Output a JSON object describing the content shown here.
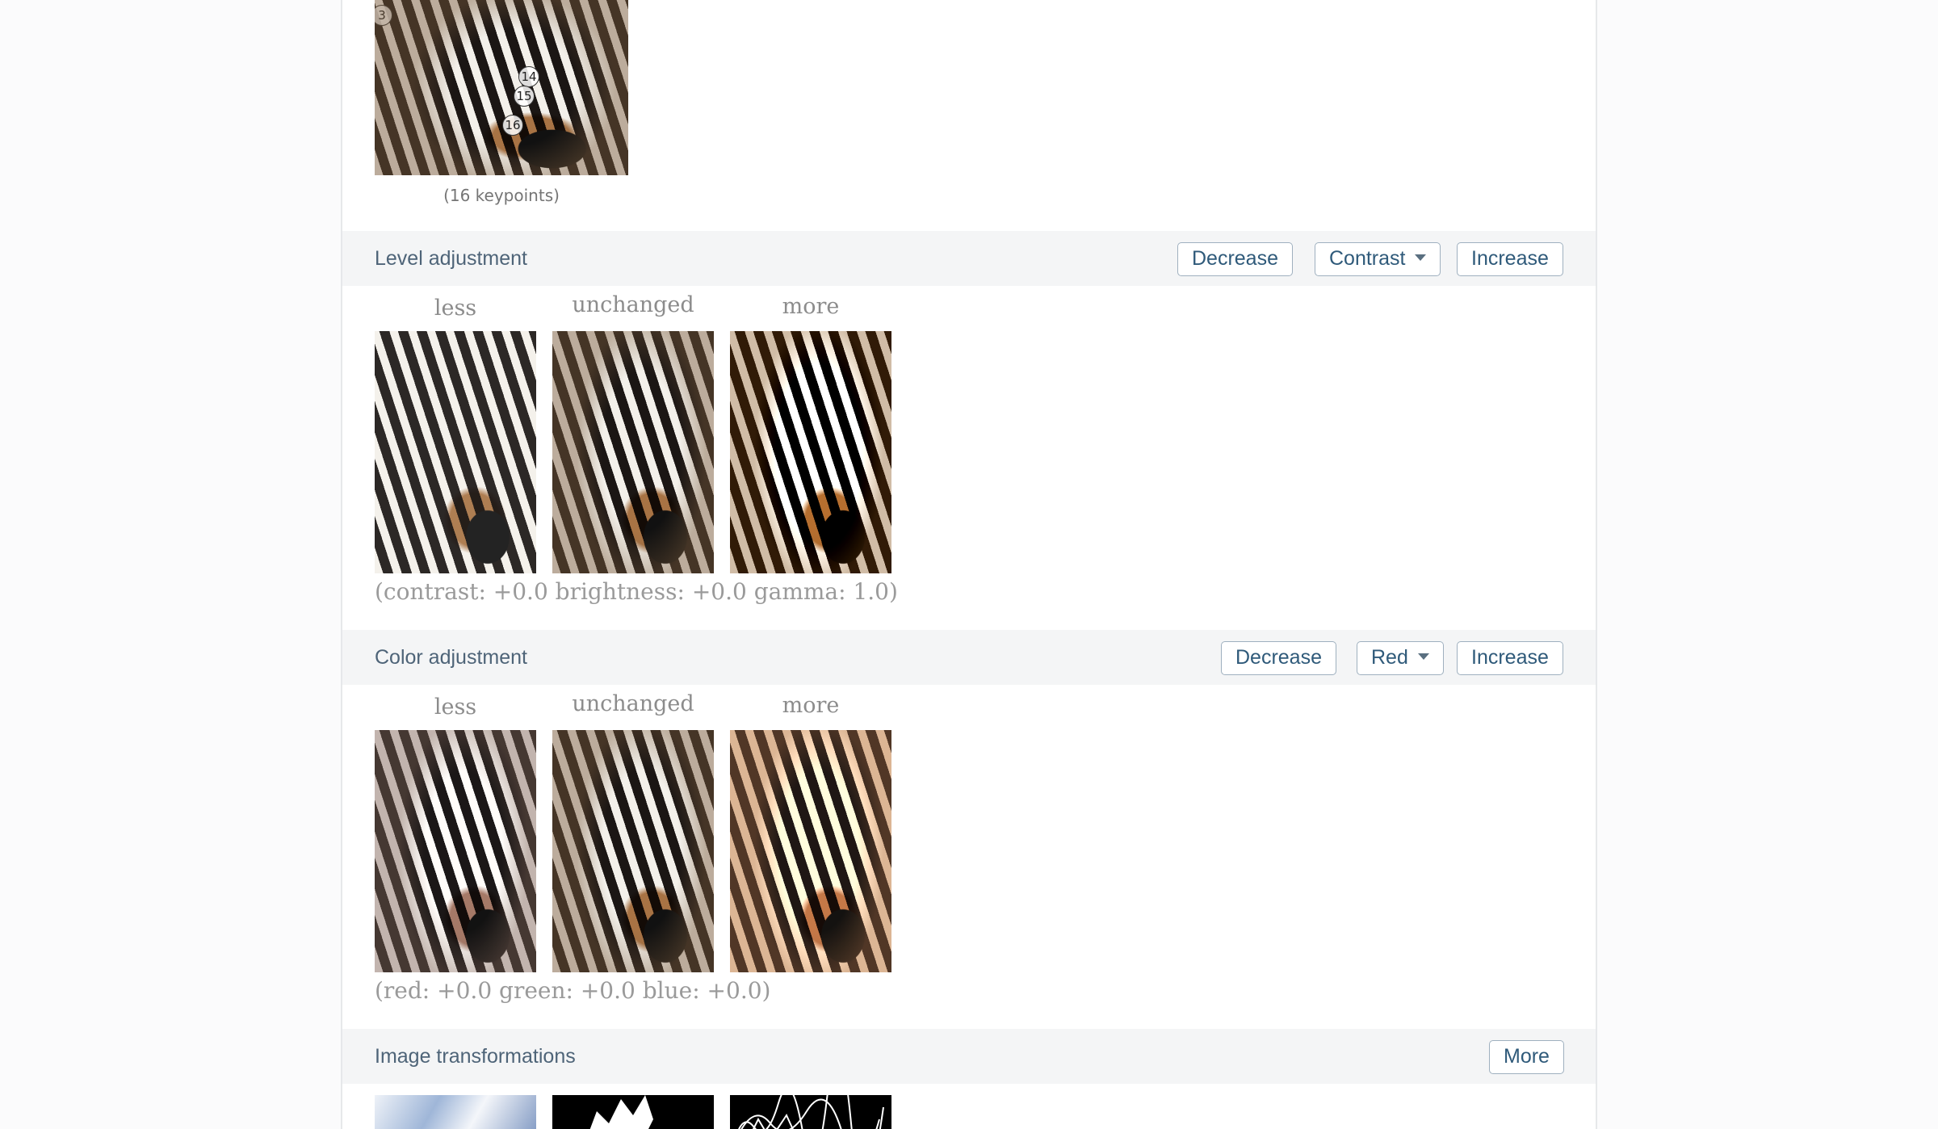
{
  "keypoints": {
    "labels": [
      "3",
      "14",
      "15",
      "16"
    ],
    "caption": "(16 keypoints)"
  },
  "level_adjustment": {
    "title": "Level adjustment",
    "decrease_label": "Decrease",
    "parameter_selected": "Contrast",
    "increase_label": "Increase",
    "thumb_labels": [
      "less",
      "unchanged",
      "more"
    ],
    "params_text": "(contrast: +0.0  brightness: +0.0  gamma: 1.0)"
  },
  "color_adjustment": {
    "title": "Color adjustment",
    "decrease_label": "Decrease",
    "channel_selected": "Red",
    "increase_label": "Increase",
    "thumb_labels": [
      "less",
      "unchanged",
      "more"
    ],
    "params_text": "(red: +0.0  green: +0.0  blue: +0.0)"
  },
  "image_transformations": {
    "title": "Image transformations",
    "more_label": "More"
  },
  "icons": {
    "dropdown": "chevron-down-icon"
  }
}
